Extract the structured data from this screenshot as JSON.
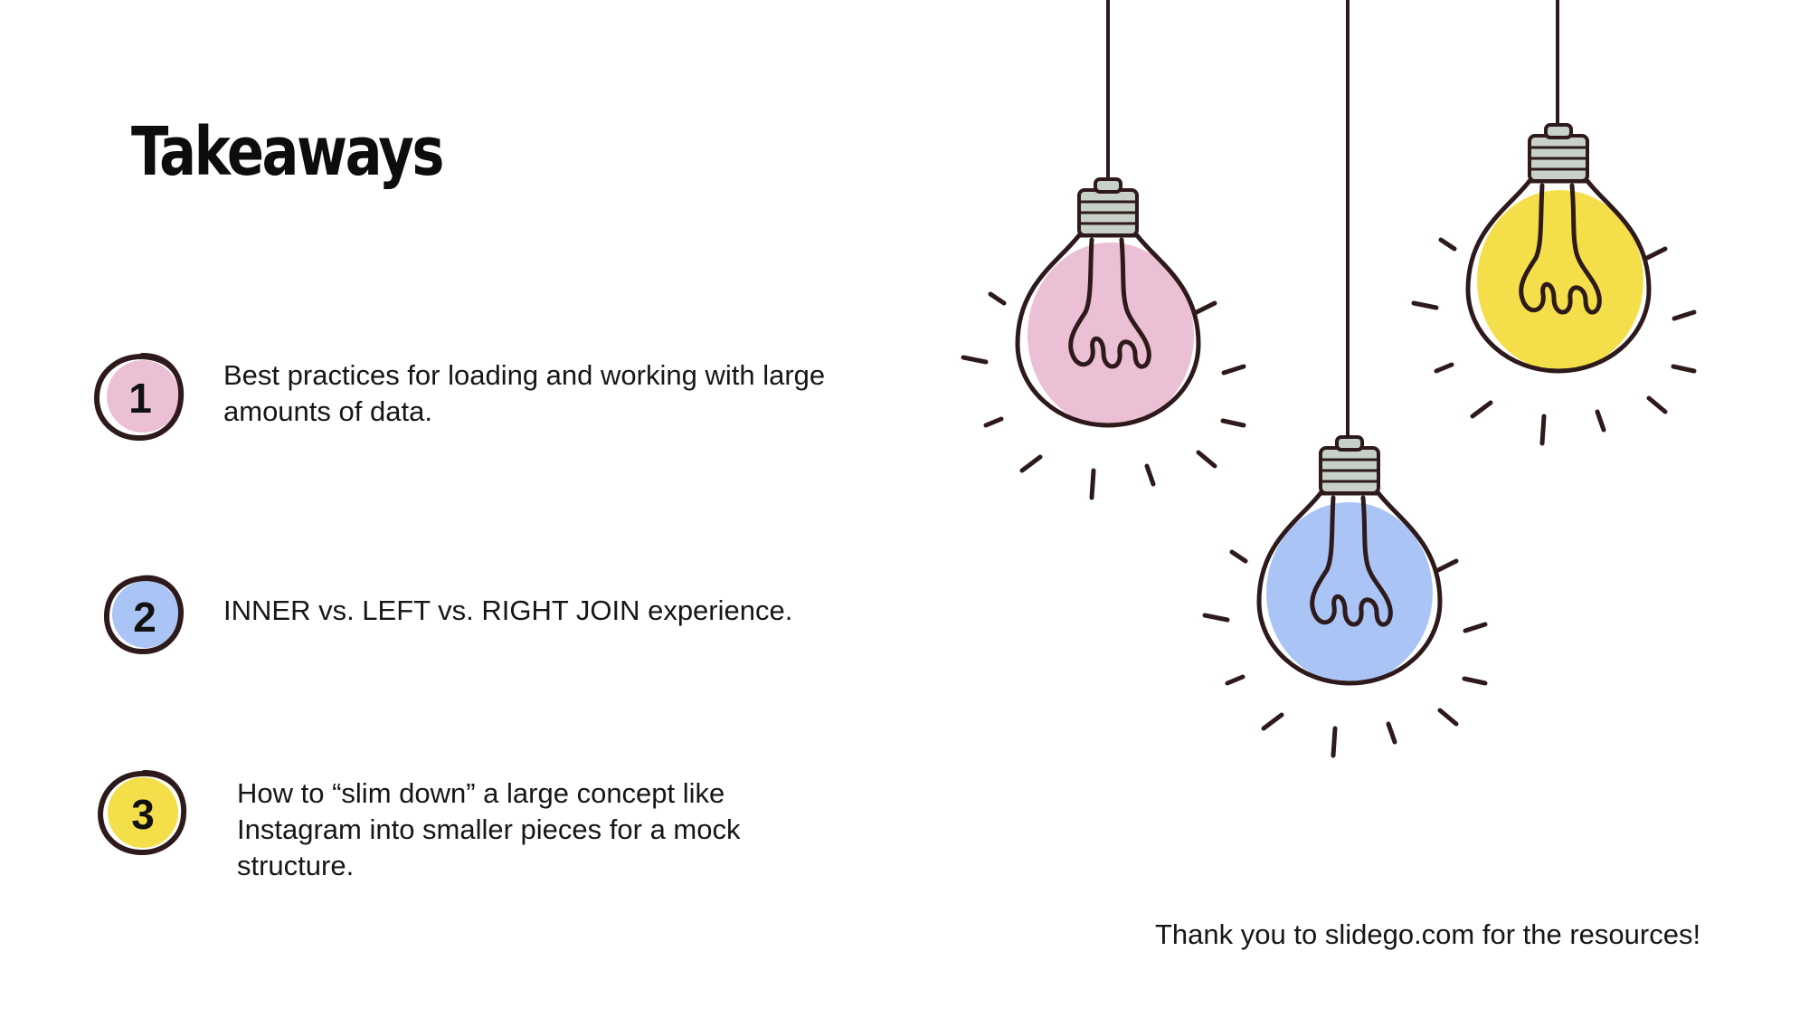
{
  "slide": {
    "title": "Takeaways",
    "items": [
      {
        "number": "1",
        "text": "Best practices for loading and working with large amounts of data.",
        "color": "#ecc0d4"
      },
      {
        "number": "2",
        "text": "INNER vs. LEFT vs. RIGHT JOIN experience.",
        "color": "#aac4f6"
      },
      {
        "number": "3",
        "text": "How to “slim down” a large concept like Instagram into smaller pieces for a mock structure.",
        "color": "#f4df4b"
      }
    ],
    "credit": "Thank you to slidego.com for the resources!"
  },
  "illustration": {
    "bulbs": [
      {
        "color": "pink",
        "fill": "#ecc0d4"
      },
      {
        "color": "blue",
        "fill": "#aac4f6"
      },
      {
        "color": "yellow",
        "fill": "#f4df4b"
      }
    ],
    "outline_color": "#2e1a1a",
    "socket_color": "#c7d1c8"
  }
}
